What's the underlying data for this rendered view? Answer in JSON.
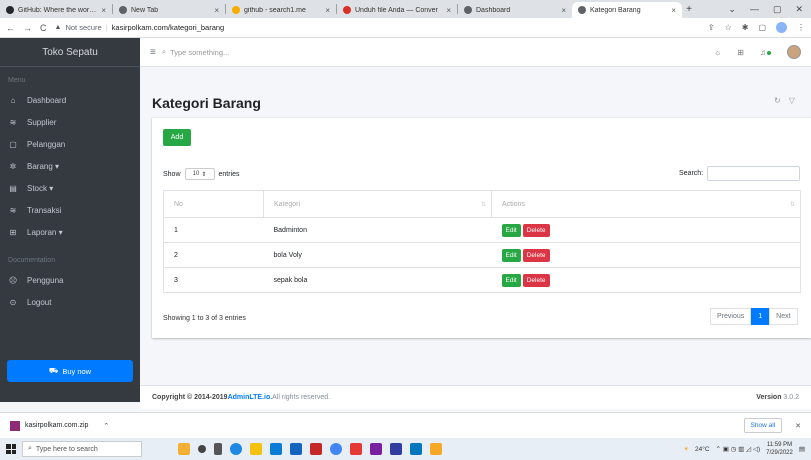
{
  "browser": {
    "tabs": [
      {
        "title": "GitHub: Where the world b",
        "fav_color": "#24292f",
        "active": false
      },
      {
        "title": "New Tab",
        "fav_color": "#5f6368",
        "active": false
      },
      {
        "title": "github - search1.me",
        "fav_color": "#f9ab00",
        "active": false
      },
      {
        "title": "Unduh file Anda — Conver",
        "fav_color": "#d93025",
        "active": false
      },
      {
        "title": "Dashboard",
        "fav_color": "#5f6368",
        "active": false
      },
      {
        "title": "Kategori Barang",
        "fav_color": "#5f6368",
        "active": true
      }
    ],
    "not_secure": "Not secure",
    "url": "kasirpolkam.com/kategori_barang"
  },
  "sidebar": {
    "brand": "Toko Sepatu",
    "menu_header": "Menu",
    "items": [
      {
        "icon": "home-icon",
        "glyph": "⌂",
        "label": "Dashboard"
      },
      {
        "icon": "layers-icon",
        "glyph": "≋",
        "label": "Supplier"
      },
      {
        "icon": "user-box-icon",
        "glyph": "▢",
        "label": "Pelanggan"
      },
      {
        "icon": "gear-icon",
        "glyph": "✲",
        "label": "Barang ▾"
      },
      {
        "icon": "box-icon",
        "glyph": "▤",
        "label": "Stock ▾"
      },
      {
        "icon": "layers-icon",
        "glyph": "≋",
        "label": "Transaksi"
      },
      {
        "icon": "grid-icon",
        "glyph": "⊞",
        "label": "Laporan ▾"
      }
    ],
    "doc_header": "Documentation",
    "doc_items": [
      {
        "icon": "users-icon",
        "glyph": "☹",
        "label": "Pengguna"
      },
      {
        "icon": "logout-icon",
        "glyph": "⊙",
        "label": "Logout"
      }
    ],
    "buy_now": "Buy now"
  },
  "topnav": {
    "search_placeholder": "Type something..."
  },
  "page": {
    "title": "Kategori Barang",
    "add_label": "Add",
    "show_label": "Show",
    "entries_value": "10",
    "entries_label": "entries",
    "search_label": "Search:",
    "columns": [
      "No",
      "Kategori",
      "Actions"
    ],
    "rows": [
      {
        "no": "1",
        "kategori": "Badminton"
      },
      {
        "no": "2",
        "kategori": "bola Voly"
      },
      {
        "no": "3",
        "kategori": "sepak bola"
      }
    ],
    "edit_label": "Edit",
    "delete_label": "Delete",
    "info": "Showing 1 to 3 of 3 entries",
    "prev_label": "Previous",
    "current_page": "1",
    "next_label": "Next"
  },
  "footer": {
    "copyright": "Copyright © 2014-2019 ",
    "brand": "AdminLTE.io.",
    "rights": " All rights reserved.",
    "version_label": "Version ",
    "version": "3.0.2"
  },
  "download": {
    "file": "kasirpolkam.com.zip",
    "show_all": "Show all"
  },
  "taskbar": {
    "search": "Type here to search",
    "weather": "24°C",
    "time": "11:59 PM",
    "date": "7/29/2022"
  }
}
